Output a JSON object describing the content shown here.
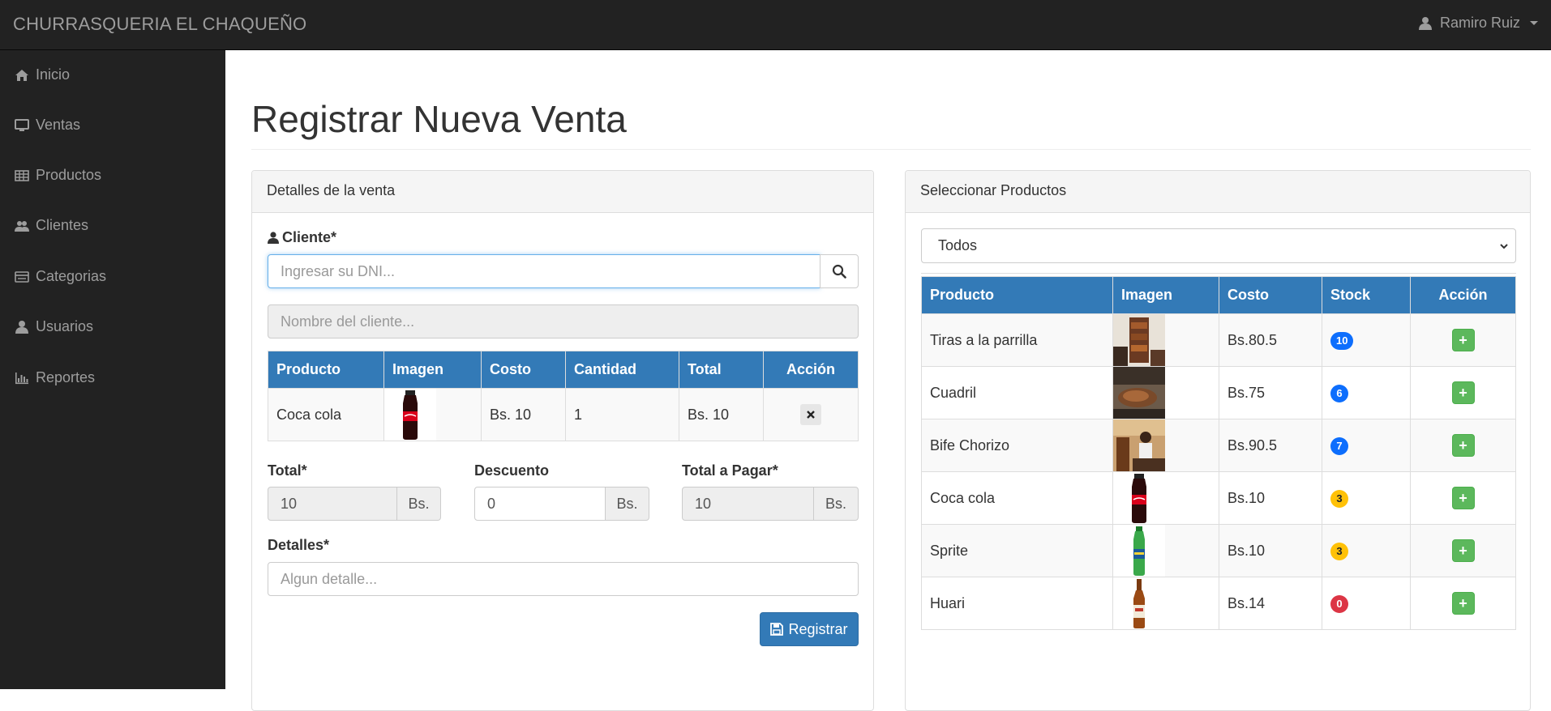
{
  "app": {
    "brand": "CHURRASQUERIA EL CHAQUEÑO",
    "user_name": "Ramiro Ruiz"
  },
  "sidebar": {
    "items": [
      {
        "label": "Inicio",
        "icon": "home-icon"
      },
      {
        "label": "Ventas",
        "icon": "monitor-icon"
      },
      {
        "label": "Productos",
        "icon": "table-icon"
      },
      {
        "label": "Clientes",
        "icon": "users-icon"
      },
      {
        "label": "Categorias",
        "icon": "list-icon"
      },
      {
        "label": "Usuarios",
        "icon": "user-icon"
      },
      {
        "label": "Reportes",
        "icon": "bar-chart-icon"
      }
    ]
  },
  "page": {
    "title": "Registrar Nueva Venta"
  },
  "sale": {
    "panel_title": "Detalles de la venta",
    "client_label": "Cliente*",
    "dni_placeholder": "Ingresar su DNI...",
    "name_placeholder": "Nombre del cliente...",
    "table_headers": [
      "Producto",
      "Imagen",
      "Costo",
      "Cantidad",
      "Total",
      "Acción"
    ],
    "rows": [
      {
        "producto": "Coca cola",
        "costo": "Bs. 10",
        "cantidad": "1",
        "total": "Bs. 10"
      }
    ],
    "total_label": "Total*",
    "total_value": "10",
    "currency": "Bs.",
    "discount_label": "Descuento",
    "discount_value": "0",
    "pay_label": "Total a Pagar*",
    "pay_value": "10",
    "details_label": "Detalles*",
    "details_placeholder": "Algun detalle...",
    "submit_label": "Registrar"
  },
  "products": {
    "panel_title": "Seleccionar Productos",
    "filter_selected": "Todos",
    "table_headers": [
      "Producto",
      "Imagen",
      "Costo",
      "Stock",
      "Acción"
    ],
    "rows": [
      {
        "producto": "Tiras a la parrilla",
        "costo": "Bs.80.5",
        "stock": "10",
        "stock_color": "#0d6efd"
      },
      {
        "producto": "Cuadril",
        "costo": "Bs.75",
        "stock": "6",
        "stock_color": "#0d6efd"
      },
      {
        "producto": "Bife Chorizo",
        "costo": "Bs.90.5",
        "stock": "7",
        "stock_color": "#0d6efd"
      },
      {
        "producto": "Coca cola",
        "costo": "Bs.10",
        "stock": "3",
        "stock_color": "#ffc107"
      },
      {
        "producto": "Sprite",
        "costo": "Bs.10",
        "stock": "3",
        "stock_color": "#ffc107"
      },
      {
        "producto": "Huari",
        "costo": "Bs.14",
        "stock": "0",
        "stock_color": "#dc3545"
      }
    ]
  }
}
